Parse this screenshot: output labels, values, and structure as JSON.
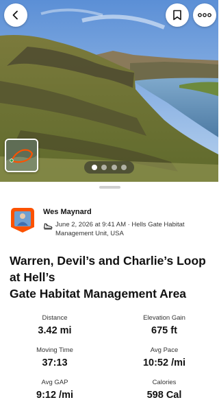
{
  "athlete": {
    "name": "Wes Maynard",
    "date_line": "June 2, 2026 at 9:41 AM · Hells Gate Habitat",
    "location_line": "Management Unit, USA"
  },
  "activity": {
    "title_line1": "Warren, Devil’s and Charlie’s Loop",
    "title_line2": "at Hell’s",
    "title_line3": "Gate Habitat Management Area"
  },
  "stats": [
    {
      "label": "Distance",
      "value": "3.42 mi"
    },
    {
      "label": "Elevation Gain",
      "value": "675 ft"
    },
    {
      "label": "Moving Time",
      "value": "37:13"
    },
    {
      "label": "Avg Pace",
      "value": "10:52 /mi"
    },
    {
      "label": "Avg GAP",
      "value": "9:12 /mi"
    },
    {
      "label": "Calories",
      "value": "598 Cal"
    }
  ],
  "photo_pager": {
    "count": 4,
    "active_index": 0
  },
  "icons": {
    "back": "chevron-left-icon",
    "bookmark": "bookmark-icon",
    "more": "more-horizontal-icon",
    "activity_type": "shoe-icon"
  },
  "colors": {
    "accent_orange": "#fc5200",
    "text_primary": "#111111",
    "text_secondary": "#333333"
  }
}
